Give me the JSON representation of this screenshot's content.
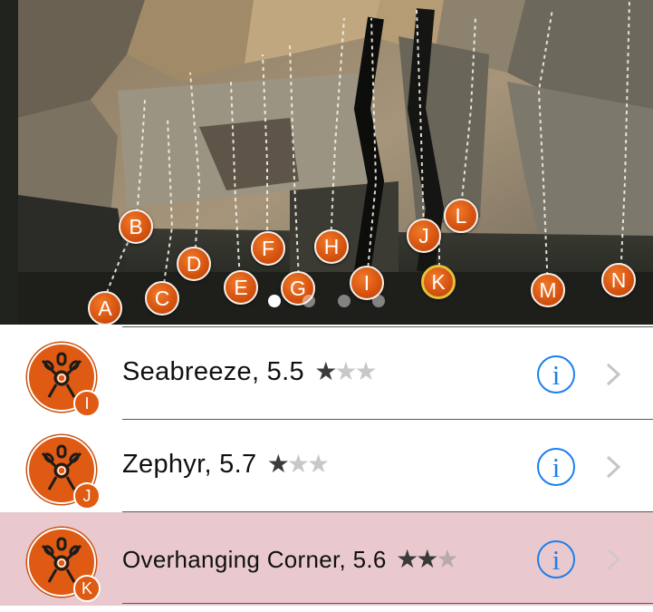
{
  "photo": {
    "route_markers": [
      {
        "label": "A",
        "selected": false
      },
      {
        "label": "B",
        "selected": false
      },
      {
        "label": "C",
        "selected": false
      },
      {
        "label": "D",
        "selected": false
      },
      {
        "label": "E",
        "selected": false
      },
      {
        "label": "F",
        "selected": false
      },
      {
        "label": "G",
        "selected": false
      },
      {
        "label": "H",
        "selected": false
      },
      {
        "label": "I",
        "selected": false
      },
      {
        "label": "J",
        "selected": false
      },
      {
        "label": "K",
        "selected": true
      },
      {
        "label": "L",
        "selected": false
      },
      {
        "label": "M",
        "selected": false
      },
      {
        "label": "N",
        "selected": false
      }
    ],
    "pager": {
      "pages": 4,
      "active_page": 1
    }
  },
  "routes": [
    {
      "name": "Seabreeze",
      "grade": "5.5",
      "text": "Seabreeze, 5.5",
      "stars": 1,
      "max_stars": 3,
      "badge": "I",
      "highlighted": false
    },
    {
      "name": "Zephyr",
      "grade": "5.7",
      "text": "Zephyr, 5.7",
      "stars": 1,
      "max_stars": 3,
      "badge": "J",
      "highlighted": false
    },
    {
      "name": "Overhanging Corner",
      "grade": "5.6",
      "text": "Overhanging Corner, 5.6",
      "stars": 2,
      "max_stars": 3,
      "badge": "K",
      "highlighted": true
    }
  ],
  "glyphs": {
    "info": "i",
    "star": "★"
  },
  "colors": {
    "accent_orange": "#df5a12",
    "info_blue": "#1a7ff0",
    "highlight_row": "#e9c9ce",
    "selected_ring": "#e3c23a"
  },
  "icons": {
    "route_avatar": "carabiner-chain-icon",
    "info": "info-circle-icon",
    "disclosure": "chevron-right-icon"
  }
}
